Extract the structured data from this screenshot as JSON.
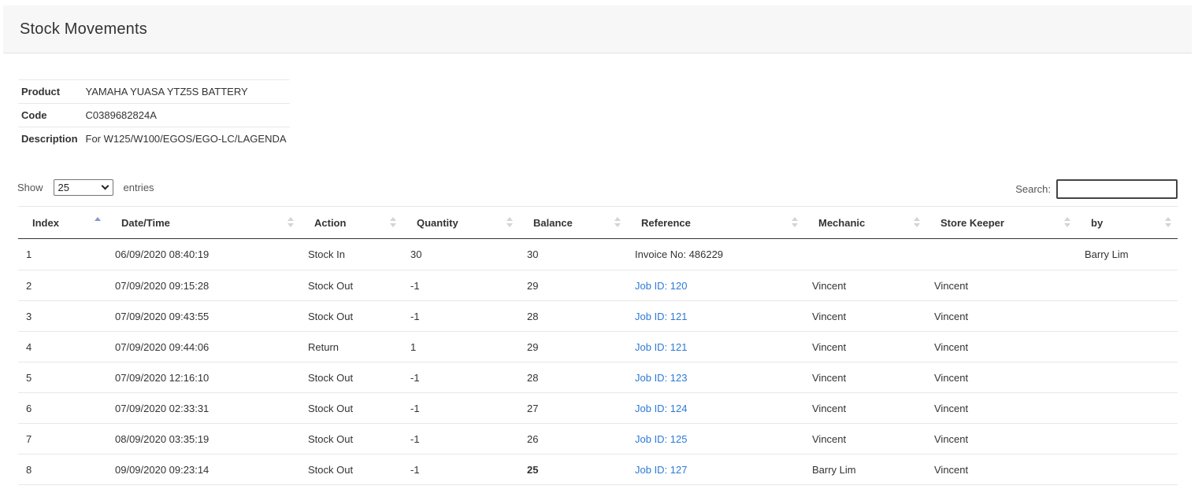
{
  "page": {
    "title": "Stock Movements"
  },
  "product_info": [
    {
      "label": "Product",
      "value": "YAMAHA YUASA YTZ5S BATTERY"
    },
    {
      "label": "Code",
      "value": "C0389682824A"
    },
    {
      "label": "Description",
      "value": "For W125/W100/EGOS/EGO-LC/LAGENDA"
    }
  ],
  "table_controls": {
    "show_label": "Show",
    "entries_value": "25",
    "entries_label": "entries",
    "search_label": "Search:",
    "search_value": ""
  },
  "columns": [
    {
      "label": "Index",
      "sort": "asc"
    },
    {
      "label": "Date/Time",
      "sort": "both"
    },
    {
      "label": "Action",
      "sort": "both"
    },
    {
      "label": "Quantity",
      "sort": "both"
    },
    {
      "label": "Balance",
      "sort": "both"
    },
    {
      "label": "Reference",
      "sort": "both"
    },
    {
      "label": "Mechanic",
      "sort": "both"
    },
    {
      "label": "Store Keeper",
      "sort": "both"
    },
    {
      "label": "by",
      "sort": "both"
    }
  ],
  "rows": [
    {
      "index": "1",
      "datetime": "06/09/2020 08:40:19",
      "action": "Stock In",
      "quantity": "30",
      "balance": "30",
      "reference": "Invoice No: 486229",
      "reference_link": false,
      "mechanic": "",
      "store_keeper": "",
      "by": "Barry Lim",
      "balance_bold": false
    },
    {
      "index": "2",
      "datetime": "07/09/2020 09:15:28",
      "action": "Stock Out",
      "quantity": "-1",
      "balance": "29",
      "reference": "Job ID: 120",
      "reference_link": true,
      "mechanic": "Vincent",
      "store_keeper": "Vincent",
      "by": "",
      "balance_bold": false
    },
    {
      "index": "3",
      "datetime": "07/09/2020 09:43:55",
      "action": "Stock Out",
      "quantity": "-1",
      "balance": "28",
      "reference": "Job ID: 121",
      "reference_link": true,
      "mechanic": "Vincent",
      "store_keeper": "Vincent",
      "by": "",
      "balance_bold": false
    },
    {
      "index": "4",
      "datetime": "07/09/2020 09:44:06",
      "action": "Return",
      "quantity": "1",
      "balance": "29",
      "reference": "Job ID: 121",
      "reference_link": true,
      "mechanic": "Vincent",
      "store_keeper": "Vincent",
      "by": "",
      "balance_bold": false
    },
    {
      "index": "5",
      "datetime": "07/09/2020 12:16:10",
      "action": "Stock Out",
      "quantity": "-1",
      "balance": "28",
      "reference": "Job ID: 123",
      "reference_link": true,
      "mechanic": "Vincent",
      "store_keeper": "Vincent",
      "by": "",
      "balance_bold": false
    },
    {
      "index": "6",
      "datetime": "07/09/2020 02:33:31",
      "action": "Stock Out",
      "quantity": "-1",
      "balance": "27",
      "reference": "Job ID: 124",
      "reference_link": true,
      "mechanic": "Vincent",
      "store_keeper": "Vincent",
      "by": "",
      "balance_bold": false
    },
    {
      "index": "7",
      "datetime": "08/09/2020 03:35:19",
      "action": "Stock Out",
      "quantity": "-1",
      "balance": "26",
      "reference": "Job ID: 125",
      "reference_link": true,
      "mechanic": "Vincent",
      "store_keeper": "Vincent",
      "by": "",
      "balance_bold": false
    },
    {
      "index": "8",
      "datetime": "09/09/2020 09:23:14",
      "action": "Stock Out",
      "quantity": "-1",
      "balance": "25",
      "reference": "Job ID: 127",
      "reference_link": true,
      "mechanic": "Barry Lim",
      "store_keeper": "Vincent",
      "by": "",
      "balance_bold": true
    }
  ],
  "colors": {
    "link": "#2d7ad6",
    "header_bg": "#f7f7f7",
    "sort_active": "#8a96c8",
    "sort_inactive": "#d4d4d4"
  }
}
